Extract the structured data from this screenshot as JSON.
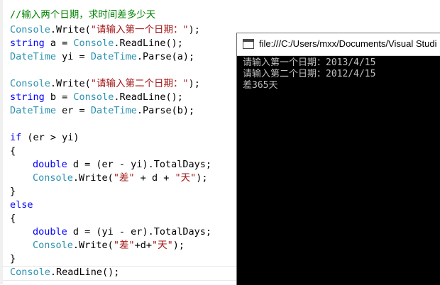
{
  "editor": {
    "lines": [
      [
        {
          "t": "//输入两个日期，求时间差多少天",
          "c": "tok-comment"
        }
      ],
      [
        {
          "t": "Console",
          "c": "tok-type"
        },
        {
          "t": ".Write(",
          "c": "tok-plain"
        },
        {
          "t": "\"请输入第一个日期：\"",
          "c": "tok-str"
        },
        {
          "t": ");",
          "c": "tok-plain"
        }
      ],
      [
        {
          "t": "string",
          "c": "tok-kw"
        },
        {
          "t": " a = ",
          "c": "tok-plain"
        },
        {
          "t": "Console",
          "c": "tok-type"
        },
        {
          "t": ".ReadLine();",
          "c": "tok-plain"
        }
      ],
      [
        {
          "t": "DateTime",
          "c": "tok-type"
        },
        {
          "t": " yi = ",
          "c": "tok-plain"
        },
        {
          "t": "DateTime",
          "c": "tok-type"
        },
        {
          "t": ".Parse(a);",
          "c": "tok-plain"
        }
      ],
      [],
      [
        {
          "t": "Console",
          "c": "tok-type"
        },
        {
          "t": ".Write(",
          "c": "tok-plain"
        },
        {
          "t": "\"请输入第二个日期：\"",
          "c": "tok-str"
        },
        {
          "t": ");",
          "c": "tok-plain"
        }
      ],
      [
        {
          "t": "string",
          "c": "tok-kw"
        },
        {
          "t": " b = ",
          "c": "tok-plain"
        },
        {
          "t": "Console",
          "c": "tok-type"
        },
        {
          "t": ".ReadLine();",
          "c": "tok-plain"
        }
      ],
      [
        {
          "t": "DateTime",
          "c": "tok-type"
        },
        {
          "t": " er = ",
          "c": "tok-plain"
        },
        {
          "t": "DateTime",
          "c": "tok-type"
        },
        {
          "t": ".Parse(b);",
          "c": "tok-plain"
        }
      ],
      [],
      [
        {
          "t": "if",
          "c": "tok-kw"
        },
        {
          "t": " (er > yi)",
          "c": "tok-plain"
        }
      ],
      [
        {
          "t": "{",
          "c": "tok-plain"
        }
      ],
      [
        {
          "t": "double",
          "c": "tok-kw"
        },
        {
          "t": " d = (er - yi).TotalDays;",
          "c": "tok-plain"
        }
      ],
      [
        {
          "t": "Console",
          "c": "tok-type"
        },
        {
          "t": ".Write(",
          "c": "tok-plain"
        },
        {
          "t": "\"差\"",
          "c": "tok-str"
        },
        {
          "t": " + d + ",
          "c": "tok-plain"
        },
        {
          "t": "\"天\"",
          "c": "tok-str"
        },
        {
          "t": ");",
          "c": "tok-plain"
        }
      ],
      [
        {
          "t": "}",
          "c": "tok-plain"
        }
      ],
      [
        {
          "t": "else",
          "c": "tok-kw"
        }
      ],
      [
        {
          "t": "{",
          "c": "tok-plain"
        }
      ],
      [
        {
          "t": "double",
          "c": "tok-kw"
        },
        {
          "t": " d = (yi - er).TotalDays;",
          "c": "tok-plain"
        }
      ],
      [
        {
          "t": "Console",
          "c": "tok-type"
        },
        {
          "t": ".Write(",
          "c": "tok-plain"
        },
        {
          "t": "\"差\"",
          "c": "tok-str"
        },
        {
          "t": "+d+",
          "c": "tok-plain"
        },
        {
          "t": "\"天\"",
          "c": "tok-str"
        },
        {
          "t": ");",
          "c": "tok-plain"
        }
      ],
      [
        {
          "t": "}",
          "c": "tok-plain"
        }
      ],
      [
        {
          "t": "Console",
          "c": "tok-type"
        },
        {
          "t": ".ReadLine();",
          "c": "tok-plain"
        }
      ]
    ]
  },
  "console": {
    "title": "file:///C:/Users/mxx/Documents/Visual Studi",
    "lines": [
      "请输入第一个日期：2013/4/15",
      "请输入第二个日期：2012/4/15",
      "差365天"
    ]
  }
}
